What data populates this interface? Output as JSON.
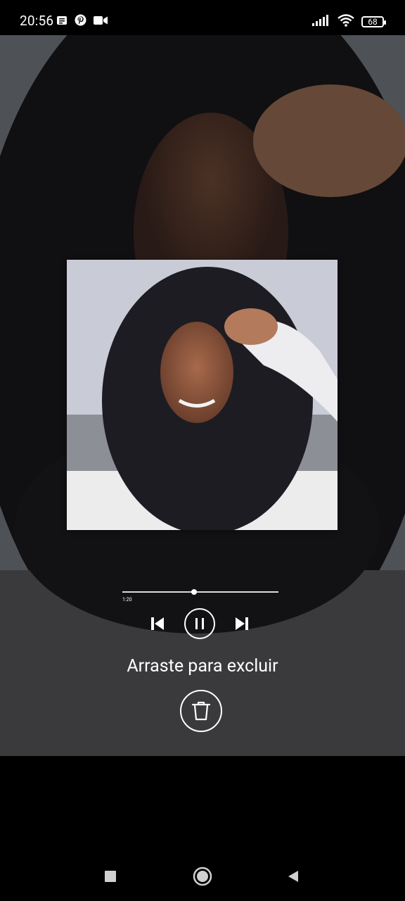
{
  "status_bar": {
    "time": "20:56",
    "battery": "68",
    "left_icons": [
      "notes-icon",
      "pinterest-icon",
      "video-camera-icon"
    ],
    "right_icons": [
      "signal-icon",
      "wifi-icon",
      "battery-icon"
    ]
  },
  "player": {
    "elapsed": "1:20",
    "progress": 0.46,
    "controls": [
      "previous-icon",
      "pause-icon",
      "next-icon"
    ]
  },
  "delete": {
    "hint": "Arraste para excluir",
    "icon": "trash-icon"
  },
  "nav_bar": {
    "buttons": [
      "recents",
      "home",
      "back"
    ]
  },
  "colors": {
    "text": "#ffffff",
    "background": "#000000"
  }
}
